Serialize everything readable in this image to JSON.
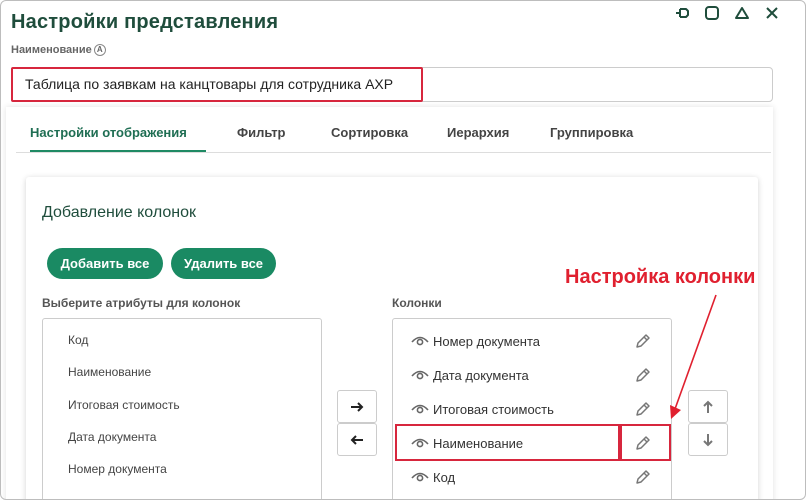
{
  "window": {
    "title": "Настройки представления",
    "controls": [
      "pin-icon",
      "maximize-icon",
      "minimize-icon",
      "close-icon"
    ]
  },
  "name_field": {
    "label": "Наименование",
    "info": "A",
    "value": "Таблица по заявкам на канцтовары для сотрудника АХР"
  },
  "tabs": [
    {
      "label": "Настройки отображения",
      "active": true
    },
    {
      "label": "Фильтр"
    },
    {
      "label": "Сортировка"
    },
    {
      "label": "Иерархия"
    },
    {
      "label": "Группировка"
    }
  ],
  "columns_section": {
    "title": "Добавление колонок",
    "add_all": "Добавить все",
    "remove_all": "Удалить все",
    "attributes_label": "Выберите атрибуты для колонок",
    "attributes": [
      "Код",
      "Наименование",
      "Итоговая стоимость",
      "Дата документа",
      "Номер документа"
    ],
    "columns_label": "Колонки",
    "columns": [
      "Номер документа",
      "Дата документа",
      "Итоговая стоимость",
      "Наименование",
      "Код"
    ]
  },
  "annotation": {
    "text": "Настройка колонки",
    "color": "#e0202f"
  },
  "colors": {
    "accent": "#1a8a63",
    "title": "#1f4d3c",
    "highlight": "#d7263d"
  }
}
